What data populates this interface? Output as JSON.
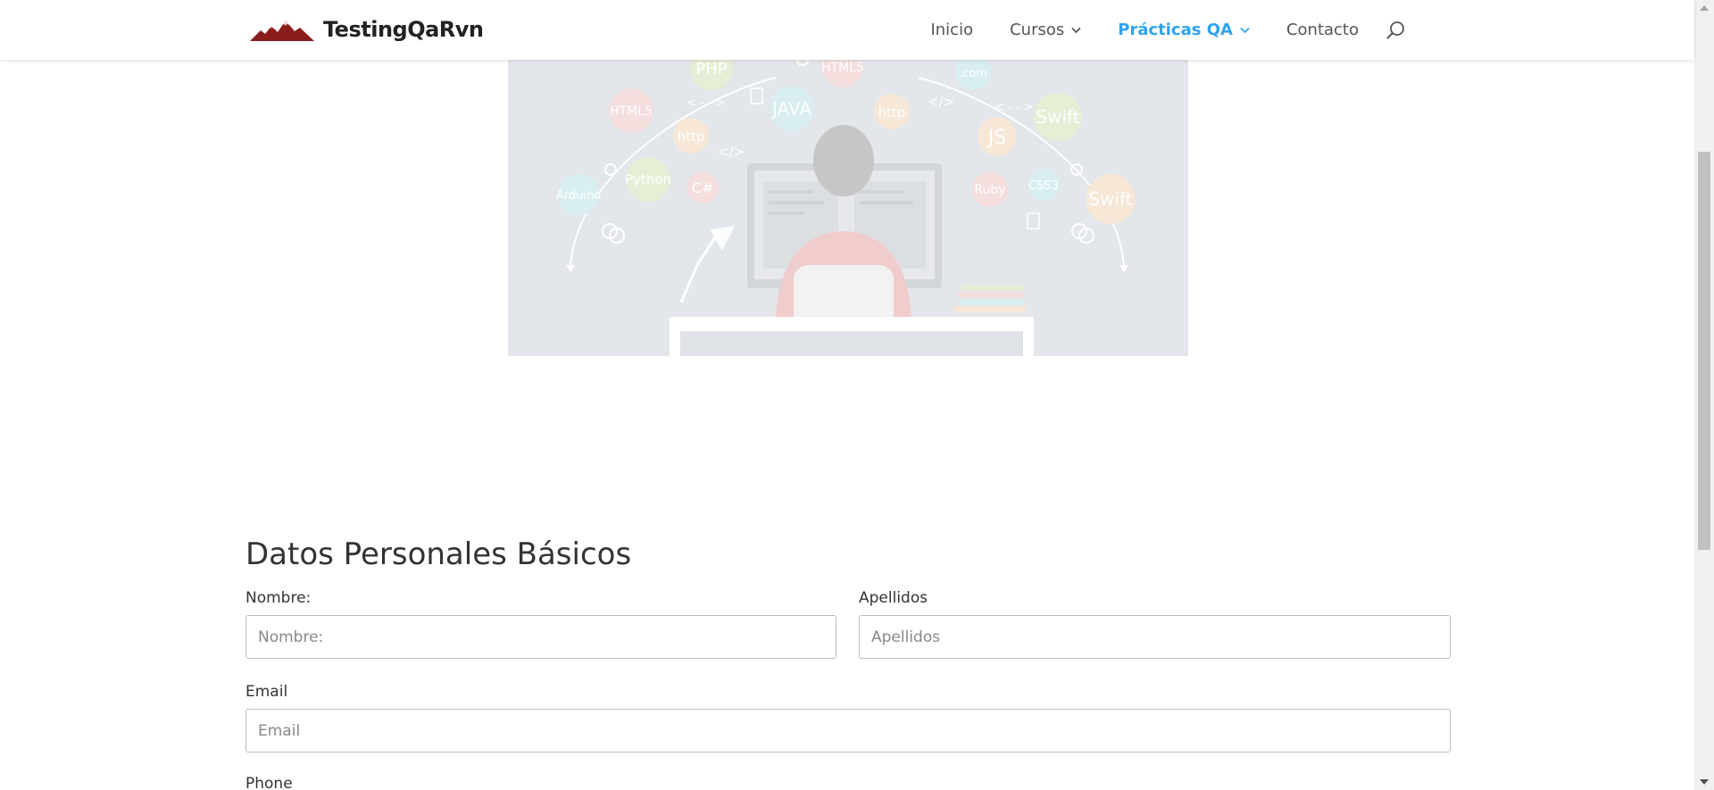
{
  "header": {
    "logo_text": "TestingQaRvn",
    "nav": {
      "inicio": "Inicio",
      "cursos": "Cursos",
      "practicas": "Prácticas QA",
      "contacto": "Contacto"
    }
  },
  "hero": {
    "bubbles": {
      "php": "PHP",
      "html5_a": "HTML5",
      "html5_b": "HTML5",
      "com": ".com",
      "java": "JAVA",
      "http_a": "http",
      "http_b": "http",
      "swift_a": "Swift",
      "swift_b": "Swift",
      "js": "JS",
      "arduino": "Arduino",
      "python": "Python",
      "csharp": "C#",
      "ruby": "Ruby",
      "css3": "CSS3"
    },
    "code_glyphs": {
      "arrows_a": "< - - >",
      "arrows_b": "< - - >",
      "tag_a": "</>",
      "tag_b": "</>"
    }
  },
  "form": {
    "title": "Datos Personales Básicos",
    "nombre": {
      "label": "Nombre:",
      "placeholder": "Nombre:",
      "value": ""
    },
    "apellidos": {
      "label": "Apellidos",
      "placeholder": "Apellidos",
      "value": ""
    },
    "email": {
      "label": "Email",
      "placeholder": "Email",
      "value": ""
    },
    "phone": {
      "label": "Phone"
    }
  },
  "colors": {
    "accent": "#2ea3f2",
    "nav_text": "#555555",
    "logo_red": "#8b1c1c",
    "hero_bg": "#e3e6ea"
  },
  "icons": {
    "logo": "mountain-logo-icon",
    "search": "search-icon",
    "dropdown": "chevron-down-icon"
  }
}
